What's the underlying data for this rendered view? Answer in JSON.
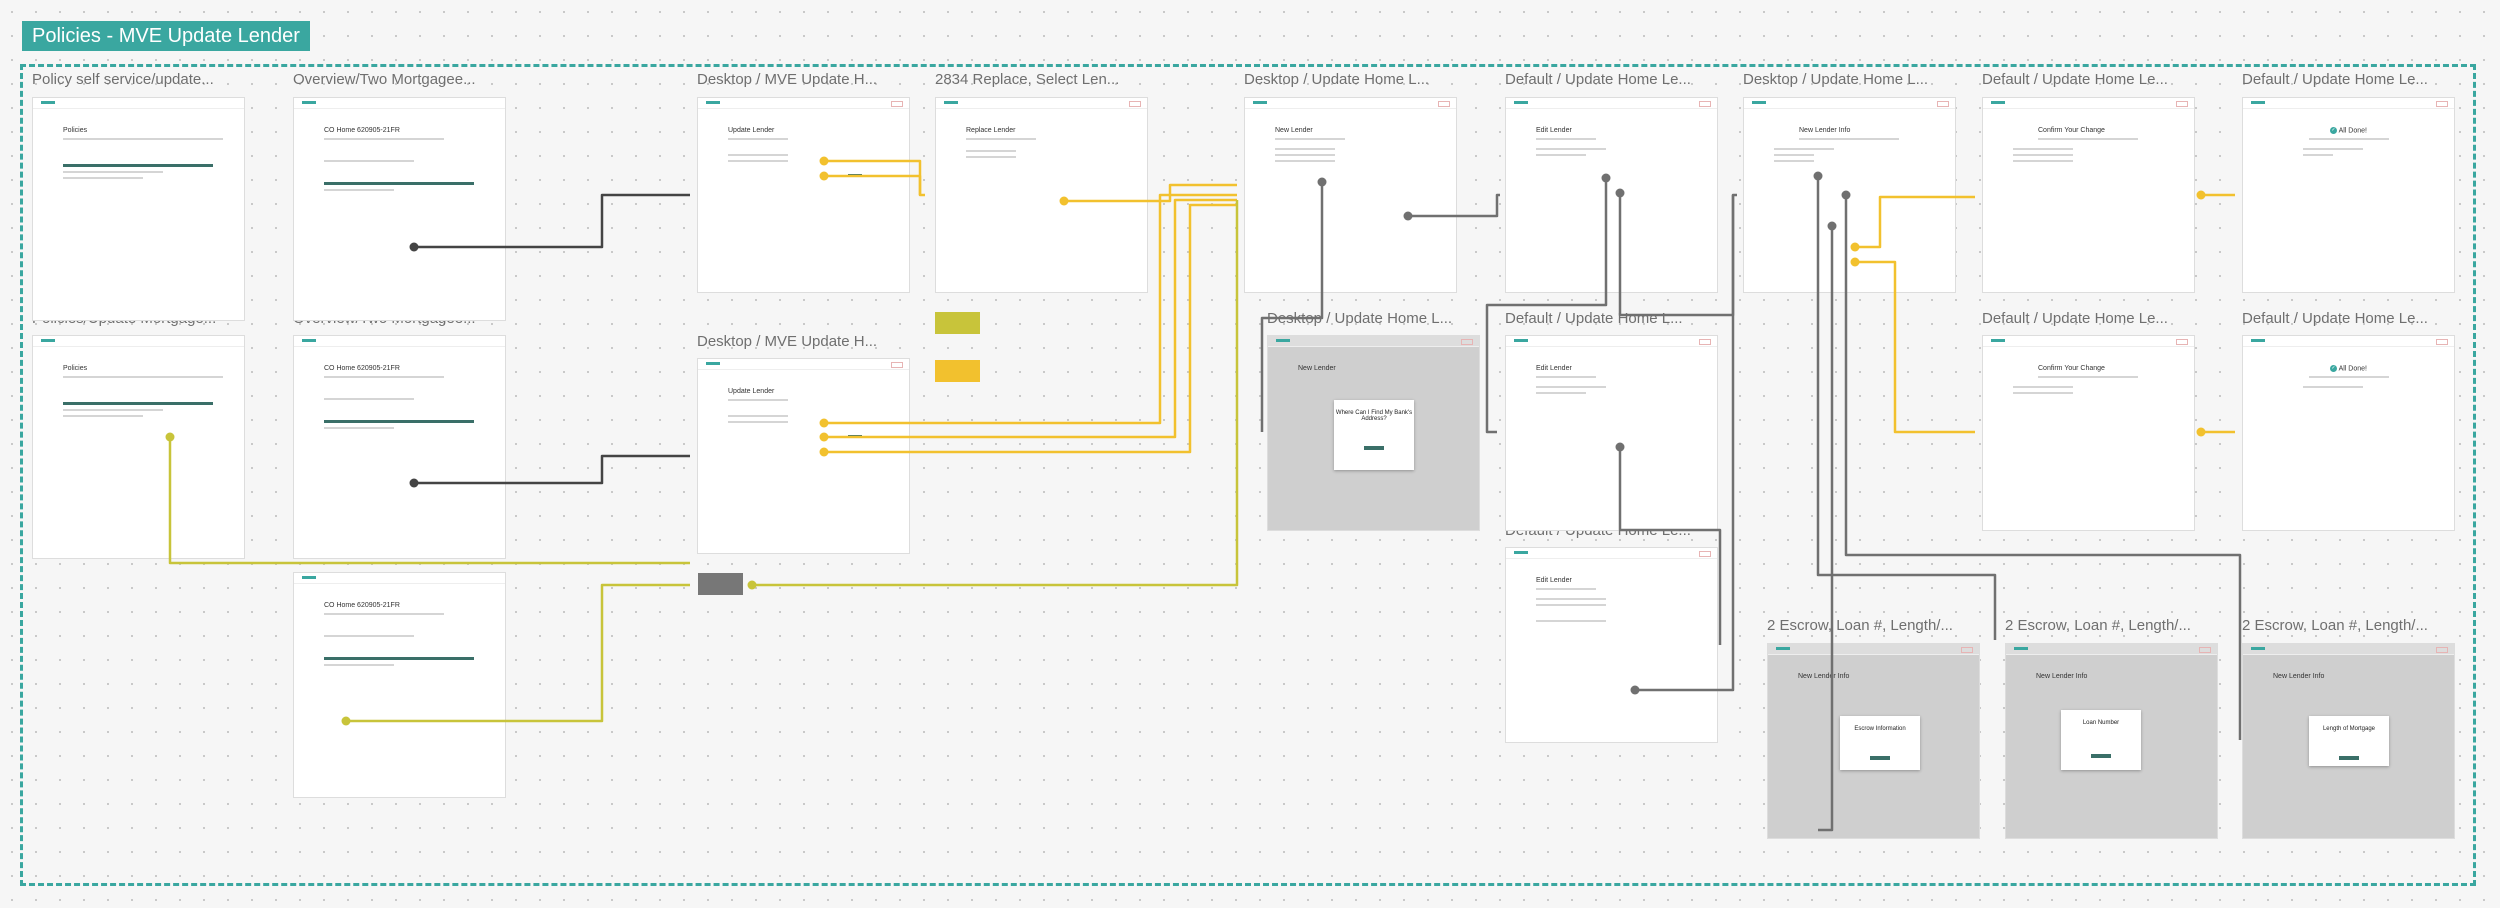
{
  "board": {
    "title": "Policies - MVE Update Lender"
  },
  "frame_labels": [
    "Policy self service/update...",
    "Overview/Two Mortgagee...",
    "Desktop / MVE Update H...",
    "2834 Replace, Select Len...",
    "Desktop / Update Home L...",
    "Default / Update Home Le...",
    "Desktop / Update Home L...",
    "Default / Update Home Le...",
    "Default / Update Home Le...",
    "Policies/Update Mortgage...",
    "Overview/Two Mortgagee...",
    "Desktop / MVE Update H...",
    "Desktop / Update Home L...",
    "Default / Update Home L...",
    "Default / Update Home Le...",
    "Default / Update Home Le...",
    "Default / Update Home Le...",
    "2 Escrow, Loan #, Length/...",
    "2 Escrow, Loan #, Length/...",
    "2 Escrow, Loan #, Length/..."
  ],
  "screens": {
    "policies": "Policies",
    "co_home": "CO Home 620905-21FR",
    "update_lender": "Update Lender",
    "replace_lender": "Replace Lender",
    "new_lender": "New Lender",
    "edit_lender": "Edit Lender",
    "new_lender_info": "New Lender Info",
    "confirm_change": "Confirm Your Change",
    "all_done": "All Done!"
  },
  "modals": {
    "bank_address": "Where Can I Find My Bank's Address?",
    "escrow": "Escrow Information",
    "loan_number": "Loan Number",
    "length_mortgage": "Length of Mortgage"
  },
  "colors": {
    "accent": "#3aa7a0",
    "connector_dark": "#444444",
    "connector_yellow": "#f2c12e",
    "connector_olive": "#c8c43a",
    "connector_gray": "#707070"
  }
}
